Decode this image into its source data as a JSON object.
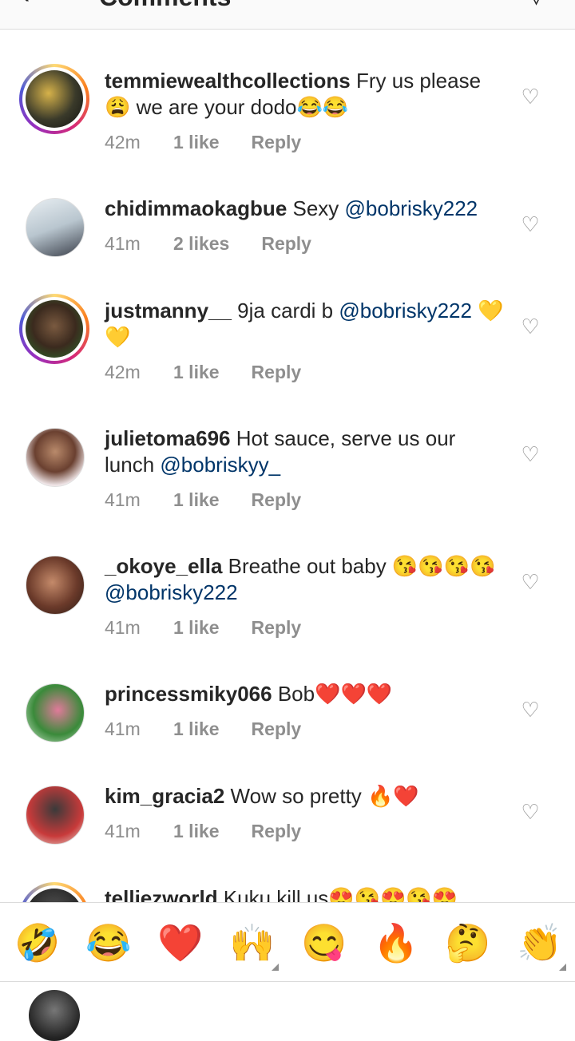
{
  "header": {
    "back_icon": "‹",
    "title": "Comments",
    "share_icon": "▽"
  },
  "comments": [
    {
      "username": "temmiewealthcollections",
      "text": " Fry us please 😩 we are your dodo😂😂",
      "mention": "",
      "time": "42m",
      "likes": "1 like",
      "reply": "Reply",
      "ring": true
    },
    {
      "username": "chidimmaokagbue",
      "text": " Sexy ",
      "mention": "@bobrisky222",
      "time": "41m",
      "likes": "2 likes",
      "reply": "Reply",
      "ring": false
    },
    {
      "username": "justmanny__",
      "text": " 9ja cardi b ",
      "mention": "@bobrisky222",
      "after": " 💛💛",
      "time": "42m",
      "likes": "1 like",
      "reply": "Reply",
      "ring": true
    },
    {
      "username": "julietoma696",
      "text": " Hot sauce, serve us our lunch ",
      "mention": "@bobriskyy_",
      "time": "41m",
      "likes": "1 like",
      "reply": "Reply",
      "ring": false
    },
    {
      "username": "_okoye_ella",
      "text": " Breathe out baby 😘😘😘😘",
      "mention": "@bobrisky222",
      "time": "41m",
      "likes": "1 like",
      "reply": "Reply",
      "ring": false
    },
    {
      "username": "princessmiky066",
      "text": " Bob❤️❤️❤️",
      "mention": "",
      "time": "41m",
      "likes": "1 like",
      "reply": "Reply",
      "ring": false
    },
    {
      "username": "kim_gracia2",
      "text": " Wow so pretty 🔥❤️",
      "mention": "",
      "time": "41m",
      "likes": "1 like",
      "reply": "Reply",
      "ring": false
    },
    {
      "username": "telliezworld",
      "text": " Kuku kill us😍😘😍😘😍",
      "mention": "",
      "time": "",
      "likes": "",
      "reply": "",
      "ring": true
    }
  ],
  "emoji_bar": [
    "🤣",
    "😂",
    "❤️",
    "🙌",
    "😋",
    "🔥",
    "🤔",
    "👏"
  ],
  "icons": {
    "heart": "heart-outline-icon"
  },
  "colors": {
    "mention": "#003569",
    "meta": "#8e8e8e",
    "text": "#262626"
  }
}
